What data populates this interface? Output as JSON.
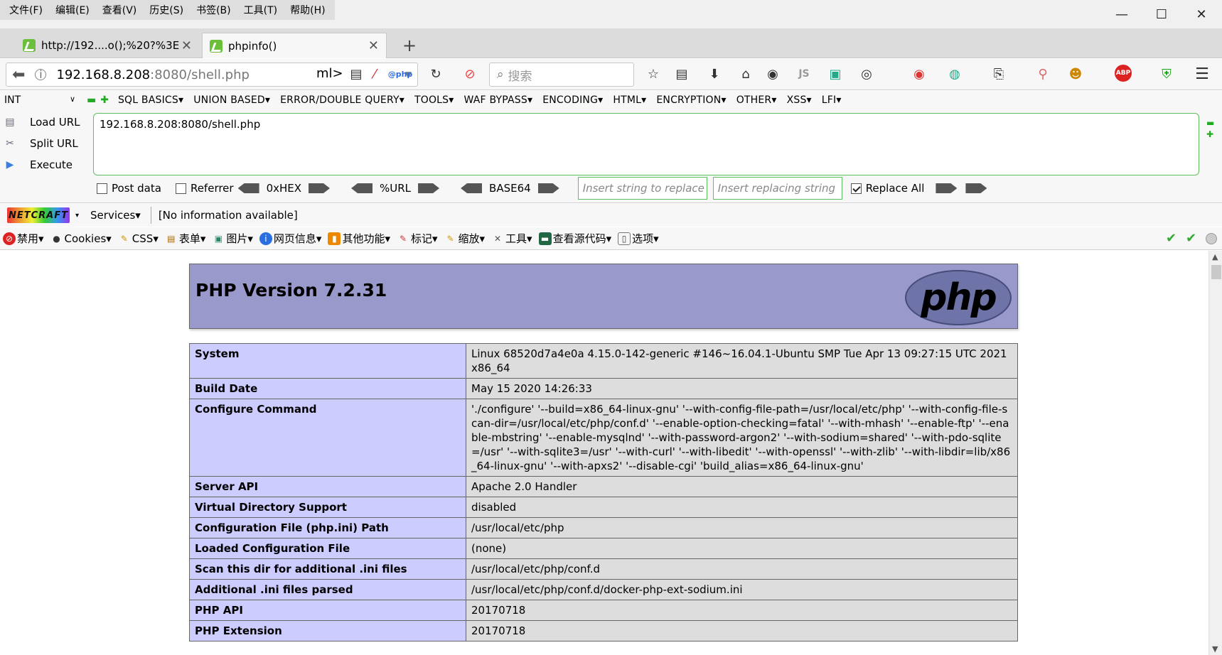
{
  "menubar": {
    "items": [
      "文件(F)",
      "编辑(E)",
      "查看(V)",
      "历史(S)",
      "书签(B)",
      "工具(T)",
      "帮助(H)"
    ],
    "minimize": "—",
    "maximize": "☐",
    "close": "✕"
  },
  "tabs": [
    {
      "title": "http://192....o();%20?%3E",
      "close": "✕"
    },
    {
      "title": "phpinfo()",
      "close": "✕"
    }
  ],
  "new_tab": "+",
  "navbar": {
    "url_host": "192.168.8.208",
    "url_rest": ":8080/shell.php",
    "ml": "ml>",
    "search_placeholder": "搜索"
  },
  "hackbar": {
    "select_value": "INT",
    "menu": [
      "SQL BASICS▾",
      "UNION BASED▾",
      "ERROR/DOUBLE QUERY▾",
      "TOOLS▾",
      "WAF BYPASS▾",
      "ENCODING▾",
      "HTML▾",
      "ENCRYPTION▾",
      "OTHER▾",
      "XSS▾",
      "LFI▾"
    ],
    "load_url": "Load URL",
    "split_url": "Split URL",
    "execute": "Execute",
    "textarea": "192.168.8.208:8080/shell.php",
    "post_data": "Post data",
    "referrer": "Referrer",
    "hex": "0xHEX",
    "urlenc": "%URL",
    "base64": "BASE64",
    "insert_placeholder": "Insert string to replace",
    "replacing_placeholder": "Insert replacing string",
    "replace_all": "Replace All"
  },
  "netcraft": {
    "logo": "NETCRAFT",
    "services": "Services▾",
    "info": "[No information available]"
  },
  "webdev": [
    "禁用▾",
    "Cookies▾",
    "CSS▾",
    "表单▾",
    "图片▾",
    "网页信息▾",
    "其他功能▾",
    "标记▾",
    "缩放▾",
    "工具▾",
    "查看源代码▾",
    "选项▾"
  ],
  "php": {
    "title": "PHP Version 7.2.31",
    "logo": "php",
    "rows": [
      {
        "k": "System",
        "v": "Linux 68520d7a4e0a 4.15.0-142-generic #146~16.04.1-Ubuntu SMP Tue Apr 13 09:27:15 UTC 2021 x86_64"
      },
      {
        "k": "Build Date",
        "v": "May 15 2020 14:26:33"
      },
      {
        "k": "Configure Command",
        "v": "'./configure' '--build=x86_64-linux-gnu' '--with-config-file-path=/usr/local/etc/php' '--with-config-file-scan-dir=/usr/local/etc/php/conf.d' '--enable-option-checking=fatal' '--with-mhash' '--enable-ftp' '--enable-mbstring' '--enable-mysqlnd' '--with-password-argon2' '--with-sodium=shared' '--with-pdo-sqlite=/usr' '--with-sqlite3=/usr' '--with-curl' '--with-libedit' '--with-openssl' '--with-zlib' '--with-libdir=lib/x86_64-linux-gnu' '--with-apxs2' '--disable-cgi' 'build_alias=x86_64-linux-gnu'"
      },
      {
        "k": "Server API",
        "v": "Apache 2.0 Handler"
      },
      {
        "k": "Virtual Directory Support",
        "v": "disabled"
      },
      {
        "k": "Configuration File (php.ini) Path",
        "v": "/usr/local/etc/php"
      },
      {
        "k": "Loaded Configuration File",
        "v": "(none)"
      },
      {
        "k": "Scan this dir for additional .ini files",
        "v": "/usr/local/etc/php/conf.d"
      },
      {
        "k": "Additional .ini files parsed",
        "v": "/usr/local/etc/php/conf.d/docker-php-ext-sodium.ini"
      },
      {
        "k": "PHP API",
        "v": "20170718"
      },
      {
        "k": "PHP Extension",
        "v": "20170718"
      }
    ]
  },
  "colors": {
    "php_header": "#9999cc",
    "php_key": "#ccccff",
    "php_value": "#dddddd",
    "hackbar_border": "#5fbf5f"
  }
}
